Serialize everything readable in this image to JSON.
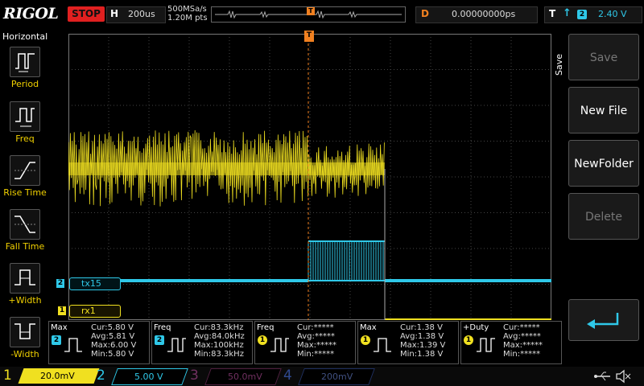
{
  "brand": "RIGOL",
  "status": "STOP",
  "horizontal": {
    "label": "H",
    "timebase": "200us",
    "sample_rate": "500MSa/s",
    "points": "1.20M pts"
  },
  "delay": {
    "label": "D",
    "value": "0.00000000ps"
  },
  "trigger": {
    "label": "T",
    "edge_icon": "rising-edge-icon",
    "source": "2",
    "level": "2.40 V",
    "marker": "T"
  },
  "left_menu": {
    "title": "Horizontal",
    "items": [
      {
        "label": "Period",
        "icon": "period-icon"
      },
      {
        "label": "Freq",
        "icon": "frequency-icon"
      },
      {
        "label": "Rise Time",
        "icon": "rise-time-icon"
      },
      {
        "label": "Fall Time",
        "icon": "fall-time-icon"
      },
      {
        "label": "+Width",
        "icon": "positive-width-icon"
      },
      {
        "label": "-Width",
        "icon": "negative-width-icon"
      }
    ]
  },
  "right_menu": {
    "title": "Save",
    "buttons": [
      {
        "label": "Save",
        "enabled": false
      },
      {
        "label": "New File",
        "enabled": true
      },
      {
        "label": "NewFolder",
        "enabled": true
      },
      {
        "label": "Delete",
        "enabled": false
      }
    ],
    "enter_icon": "enter-return-icon"
  },
  "channel_labels": [
    {
      "channel": "2",
      "label": "tx15"
    },
    {
      "channel": "1",
      "label": "rx1"
    }
  ],
  "measurements": [
    {
      "title": "Max",
      "source": "2",
      "cur": "Cur:5.80 V",
      "avg": "Avg:5.81 V",
      "max": "Max:6.00 V",
      "min": "Min:5.80 V"
    },
    {
      "title": "Freq",
      "source": "2",
      "cur": "Cur:83.3kHz",
      "avg": "Avg:84.0kHz",
      "max": "Max:100kHz",
      "min": "Min:83.3kHz"
    },
    {
      "title": "Freq",
      "source": "1",
      "cur": "Cur:*****",
      "avg": "Avg:*****",
      "max": "Max:*****",
      "min": "Min:*****"
    },
    {
      "title": "Max",
      "source": "1",
      "cur": "Cur:1.38 V",
      "avg": "Avg:1.38 V",
      "max": "Max:1.39 V",
      "min": "Min:1.38 V"
    },
    {
      "title": "+Duty",
      "source": "1",
      "cur": "Cur:*****",
      "avg": "Avg:*****",
      "max": "Max:*****",
      "min": "Min:*****"
    }
  ],
  "channels": [
    {
      "num": "1",
      "scale": "20.0mV",
      "color": "#f0e020",
      "active": true
    },
    {
      "num": "2",
      "scale": "5.00 V",
      "color": "#2fc8e8",
      "active": true
    },
    {
      "num": "3",
      "scale": "50.0mV",
      "color": "#c03090",
      "active": false
    },
    {
      "num": "4",
      "scale": "200mV",
      "color": "#3060d0",
      "active": false
    }
  ],
  "status_icons": [
    "usb-icon",
    "speaker-muted-icon"
  ],
  "colors": {
    "ch1": "#f0e020",
    "ch2": "#2fc8e8",
    "trigger": "#f08020",
    "stop": "#e02020"
  }
}
